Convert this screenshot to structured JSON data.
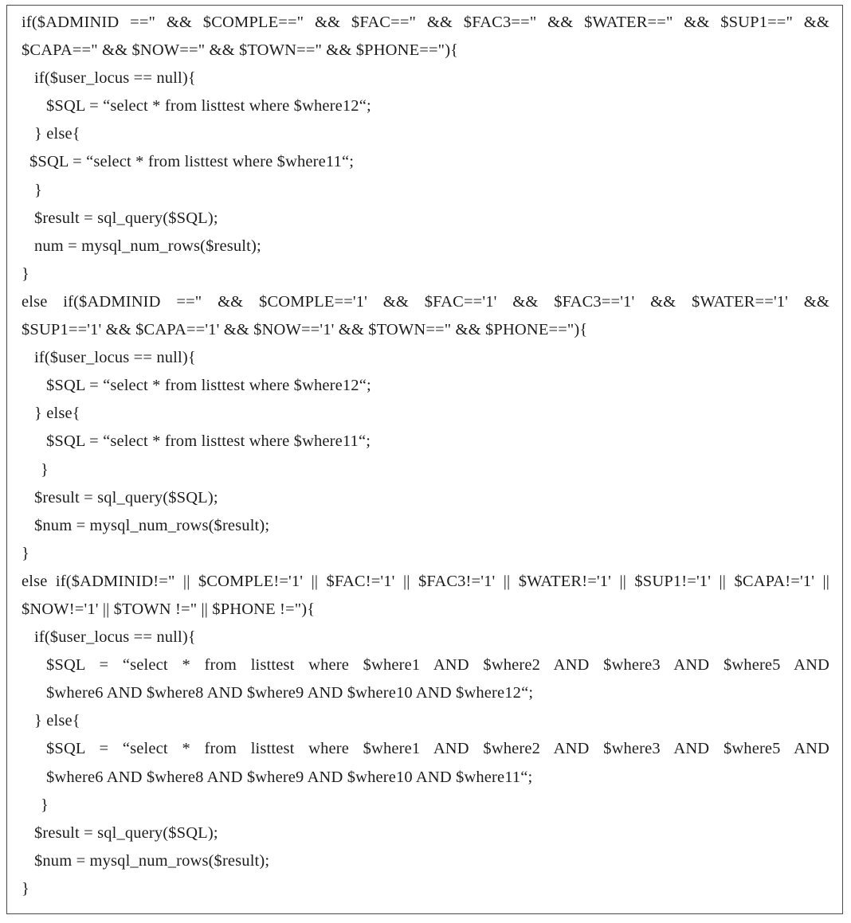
{
  "document": {
    "type": "code-listing",
    "language": "PHP",
    "background_color": "#ffffff",
    "border_color": "#4a4a4a",
    "text_color": "#1d1d1d"
  },
  "code": {
    "blocks": [
      {
        "id": "block-1",
        "lines": [
          {
            "id": "l1",
            "indent": 0,
            "wrapped": true,
            "rows": [
              "if($ADMINID ==\" && $COMPLE==\" && $FAC==\" && $FAC3==\" && $WATER==\" && $SUP1==\" &&",
              "$CAPA==\" && $NOW==\" && $TOWN==\" && $PHONE==\"){"
            ],
            "text": "if($ADMINID ==\" && $COMPLE==\" && $FAC==\" && $FAC3==\" && $WATER==\" && $SUP1==\" && $CAPA==\" && $NOW==\" && $TOWN==\" && $PHONE==\"){"
          },
          {
            "id": "l2",
            "indent": 1,
            "text": "if($user_locus == null){"
          },
          {
            "id": "l3",
            "indent": 2,
            "text": "$SQL = “select * from listtest where $where12“;"
          },
          {
            "id": "l4",
            "indent": 1,
            "text": "} else{"
          },
          {
            "id": "l5",
            "indent": 3,
            "text": "$SQL = “select * from listtest where $where11“;"
          },
          {
            "id": "l6",
            "indent": 1,
            "text": "}"
          },
          {
            "id": "l7",
            "indent": 1,
            "text": "$result = sql_query($SQL);"
          },
          {
            "id": "l8",
            "indent": 1,
            "text": "num = mysql_num_rows($result);"
          },
          {
            "id": "l9",
            "indent": 0,
            "text": "}"
          }
        ]
      },
      {
        "id": "block-2",
        "lines": [
          {
            "id": "l10",
            "indent": 0,
            "wrapped": true,
            "rows": [
              "else if($ADMINID ==\" && $COMPLE=='1' && $FAC=='1' && $FAC3=='1' && $WATER=='1' &&",
              "$SUP1=='1' && $CAPA=='1' && $NOW=='1' && $TOWN==\" && $PHONE==\"){"
            ],
            "text": "else if($ADMINID ==\" && $COMPLE=='1' && $FAC=='1' && $FAC3=='1' && $WATER=='1' && $SUP1=='1' && $CAPA=='1' && $NOW=='1' && $TOWN==\" && $PHONE==\"){"
          },
          {
            "id": "l11",
            "indent": 1,
            "text": "if($user_locus == null){"
          },
          {
            "id": "l12",
            "indent": 2,
            "text": "$SQL = “select * from listtest where $where12“;"
          },
          {
            "id": "l13",
            "indent": 1,
            "text": "} else{"
          },
          {
            "id": "l14",
            "indent": 2,
            "text": "$SQL = “select * from listtest where $where11“;"
          },
          {
            "id": "l15",
            "indent": 4,
            "text": "}"
          },
          {
            "id": "l16",
            "indent": 1,
            "text": "$result = sql_query($SQL);"
          },
          {
            "id": "l17",
            "indent": 1,
            "text": "$num = mysql_num_rows($result);"
          },
          {
            "id": "l18",
            "indent": 0,
            "text": "}"
          }
        ]
      },
      {
        "id": "block-3",
        "lines": [
          {
            "id": "l19",
            "indent": 0,
            "wrapped": true,
            "rows": [
              "else if($ADMINID!=\" || $COMPLE!='1' || $FAC!='1' || $FAC3!='1' || $WATER!='1' || $SUP1!='1' || $CAPA!='1' ||",
              "$NOW!='1' || $TOWN !=\" || $PHONE !=\"){"
            ],
            "text": "else if($ADMINID!=\" || $COMPLE!='1' || $FAC!='1' || $FAC3!='1' || $WATER!='1' || $SUP1!='1' || $CAPA!='1' || $NOW!='1' || $TOWN !=\" || $PHONE !=\"){"
          },
          {
            "id": "l20",
            "indent": 1,
            "text": "if($user_locus == null){"
          },
          {
            "id": "l21",
            "indent": 2,
            "wrapped": true,
            "rows": [
              "$SQL = “select * from listtest where $where1 AND $where2 AND $where3 AND $where5 AND",
              "$where6 AND $where8 AND $where9 AND $where10 AND $where12“;"
            ],
            "text": "$SQL = “select * from listtest where $where1 AND $where2 AND $where3 AND $where5 AND $where6 AND $where8 AND $where9 AND $where10 AND $where12“;"
          },
          {
            "id": "l22",
            "indent": 1,
            "text": "} else{"
          },
          {
            "id": "l23",
            "indent": 2,
            "wrapped": true,
            "rows": [
              "$SQL = “select * from listtest where $where1 AND $where2 AND $where3 AND $where5 AND",
              "$where6 AND $where8 AND $where9 AND $where10 AND $where11“;"
            ],
            "text": "$SQL = “select * from listtest where $where1 AND $where2 AND $where3 AND $where5 AND $where6 AND $where8 AND $where9 AND $where10 AND $where11“;"
          },
          {
            "id": "l24",
            "indent": 4,
            "text": "}"
          },
          {
            "id": "l25",
            "indent": 1,
            "text": "$result = sql_query($SQL);"
          },
          {
            "id": "l26",
            "indent": 1,
            "text": "$num = mysql_num_rows($result);"
          },
          {
            "id": "l27",
            "indent": 0,
            "text": "}"
          }
        ]
      }
    ]
  }
}
